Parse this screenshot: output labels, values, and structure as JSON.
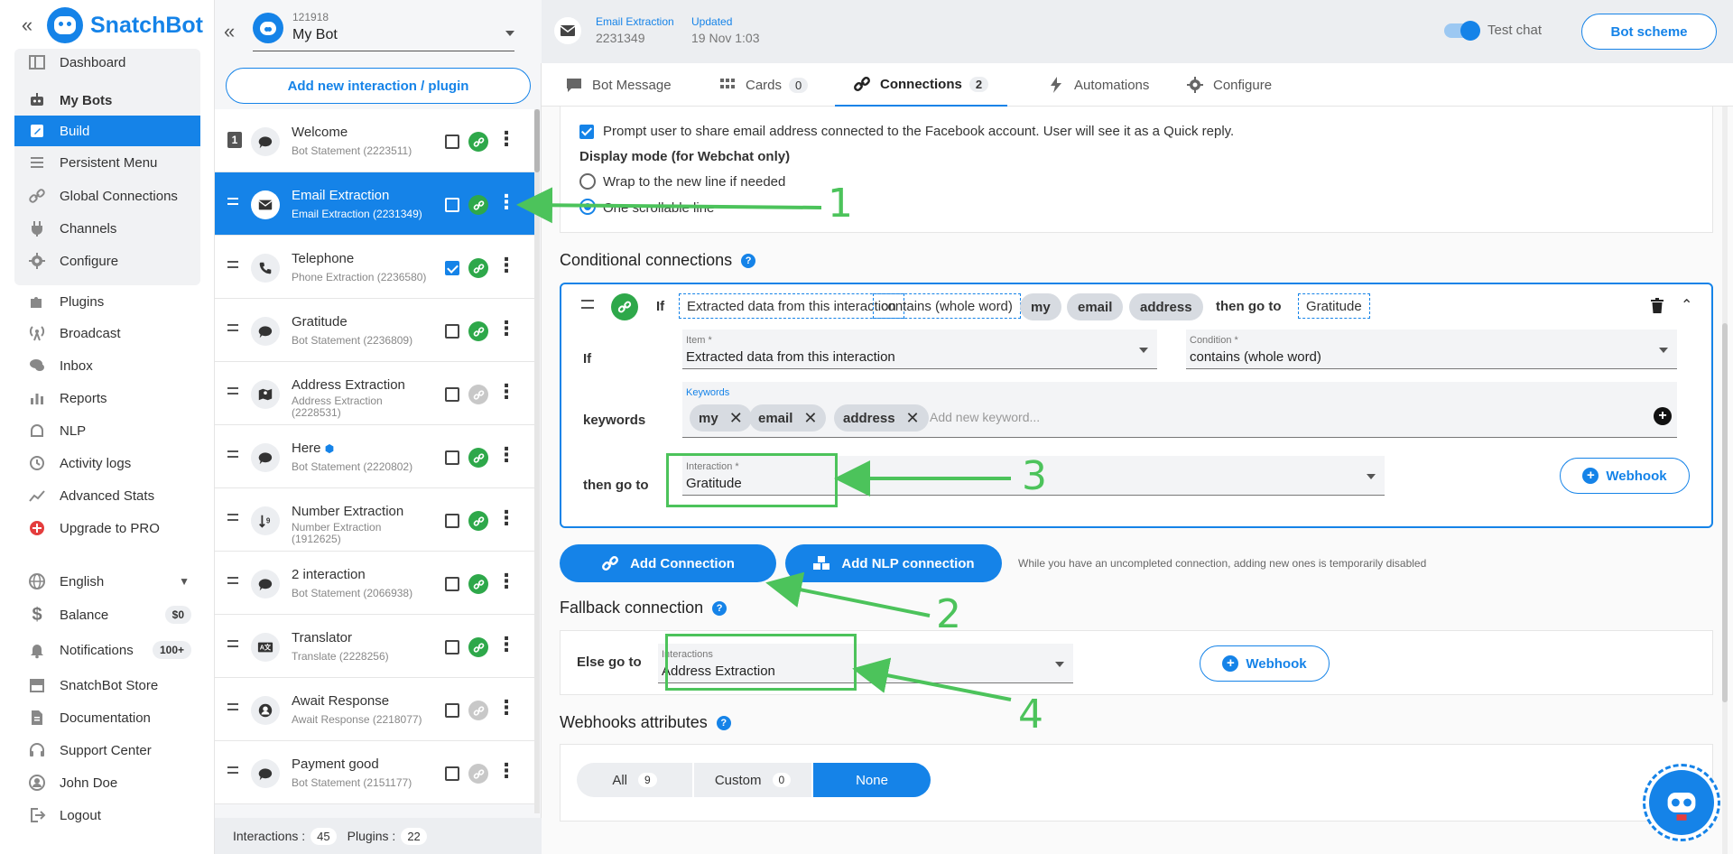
{
  "app": {
    "brand": "SnatchBot",
    "collapse_icon": "double-chevron-left-icon"
  },
  "nav": {
    "group1": [
      {
        "label": "Dashboard",
        "icon": "dashboard-icon"
      },
      {
        "label": "My Bots",
        "icon": "robot-icon"
      },
      {
        "label": "Build",
        "icon": "edit-icon"
      },
      {
        "label": "Persistent Menu",
        "icon": "menu-icon"
      },
      {
        "label": "Global Connections",
        "icon": "link-icon"
      },
      {
        "label": "Channels",
        "icon": "plug-icon"
      },
      {
        "label": "Configure",
        "icon": "gear-icon"
      }
    ],
    "group2": [
      {
        "label": "Plugins",
        "icon": "puzzle-icon"
      },
      {
        "label": "Broadcast",
        "icon": "broadcast-icon"
      },
      {
        "label": "Inbox",
        "icon": "chat-icon"
      },
      {
        "label": "Reports",
        "icon": "bar-chart-icon"
      },
      {
        "label": "NLP",
        "icon": "nlp-icon"
      },
      {
        "label": "Activity logs",
        "icon": "history-icon"
      },
      {
        "label": "Advanced Stats",
        "icon": "trend-icon"
      },
      {
        "label": "Upgrade to PRO",
        "icon": "upgrade-icon"
      }
    ],
    "group3": [
      {
        "label": "English",
        "icon": "globe-icon"
      },
      {
        "label": "Balance",
        "icon": "dollar-icon",
        "badge": "$0"
      },
      {
        "label": "Notifications",
        "icon": "bell-icon",
        "badge": "100+"
      },
      {
        "label": "SnatchBot Store",
        "icon": "store-icon"
      },
      {
        "label": "Documentation",
        "icon": "document-icon"
      },
      {
        "label": "Support Center",
        "icon": "support-icon"
      },
      {
        "label": "John Doe",
        "icon": "user-icon"
      },
      {
        "label": "Logout",
        "icon": "logout-icon"
      }
    ]
  },
  "bot": {
    "id": "121918",
    "name": "My Bot"
  },
  "interactions_panel": {
    "add_button": "Add new interaction / plugin",
    "items": [
      {
        "title": "Welcome",
        "subtitle": "Bot Statement (2223511)",
        "icon": "speech-bubble-icon",
        "order": "1",
        "checked": false,
        "linked": true
      },
      {
        "title": "Email Extraction",
        "subtitle": "Email Extraction (2231349)",
        "icon": "envelope-icon",
        "checked": false,
        "linked": true,
        "active": true
      },
      {
        "title": "Telephone",
        "subtitle": "Phone Extraction (2236580)",
        "icon": "phone-icon",
        "checked": true,
        "linked": true
      },
      {
        "title": "Gratitude",
        "subtitle": "Bot Statement (2236809)",
        "icon": "speech-bubble-icon",
        "checked": false,
        "linked": true
      },
      {
        "title": "Address Extraction",
        "subtitle": "Address Extraction (2228531)",
        "icon": "map-icon",
        "checked": false,
        "linked": false
      },
      {
        "title": "Here",
        "subtitle": "Bot Statement (2220802)",
        "icon": "speech-bubble-icon",
        "checked": false,
        "linked": true
      },
      {
        "title": "Number Extraction",
        "subtitle": "Number Extraction (1912625)",
        "icon": "number-icon",
        "checked": false,
        "linked": true
      },
      {
        "title": "2 interaction",
        "subtitle": "Bot Statement (2066938)",
        "icon": "speech-bubble-icon",
        "checked": false,
        "linked": true
      },
      {
        "title": "Translator",
        "subtitle": "Translate (2228256)",
        "icon": "translate-icon",
        "checked": false,
        "linked": true
      },
      {
        "title": "Await Response",
        "subtitle": "Await Response (2218077)",
        "icon": "user-circle-icon",
        "checked": false,
        "linked": false
      },
      {
        "title": "Payment good",
        "subtitle": "Bot Statement (2151177)",
        "icon": "speech-bubble-icon",
        "checked": false,
        "linked": false
      }
    ],
    "footer": {
      "interactions_label": "Interactions :",
      "interactions_count": "45",
      "plugins_label": "Plugins :",
      "plugins_count": "22"
    }
  },
  "header": {
    "interaction_type": "Email Extraction",
    "interaction_id": "2231349",
    "updated_label": "Updated",
    "updated_value": "19 Nov 1:03",
    "test_chat_label": "Test chat",
    "bot_scheme_label": "Bot scheme"
  },
  "tabs": [
    {
      "label": "Bot Message",
      "icon": "message-icon"
    },
    {
      "label": "Cards",
      "icon": "grid-icon",
      "badge": "0"
    },
    {
      "label": "Connections",
      "icon": "link-icon",
      "badge": "2",
      "active": true
    },
    {
      "label": "Automations",
      "icon": "bolt-icon"
    },
    {
      "label": "Configure",
      "icon": "gear-icon"
    }
  ],
  "settings_card": {
    "prompt_text": "Prompt user to share email address connected to the Facebook account. User will see it as a Quick reply.",
    "display_mode_label": "Display mode (for Webchat only)",
    "radio_wrap": "Wrap to the new line if needed",
    "radio_scroll": "One scrollable line"
  },
  "conditional": {
    "title": "Conditional connections",
    "summary": {
      "if": "If",
      "item": "Extracted data from this interaction",
      "condition": "contains (whole word)",
      "keywords": [
        "my",
        "email",
        "address"
      ],
      "then_go_to": "then go to",
      "target": "Gratitude"
    },
    "if_label": "If",
    "item_label": "Item *",
    "item_value": "Extracted data from this interaction",
    "condition_label": "Condition *",
    "condition_value": "contains (whole word)",
    "keywords_row_label": "keywords",
    "keywords_field_label": "Keywords",
    "keywords": [
      "my",
      "email",
      "address"
    ],
    "keyword_placeholder": "Add new keyword...",
    "then_label": "then go to",
    "interaction_label": "Interaction *",
    "interaction_value": "Gratitude",
    "webhook_label": "Webhook"
  },
  "actions": {
    "add_connection": "Add Connection",
    "add_nlp": "Add NLP connection",
    "note": "While you have an uncompleted connection, adding new ones is temporarily disabled"
  },
  "fallback": {
    "title": "Fallback connection",
    "else_label": "Else go to",
    "interactions_label": "Interactions",
    "interactions_value": "Address Extraction",
    "webhook_label": "Webhook"
  },
  "webhooks_attributes": {
    "title": "Webhooks attributes",
    "segments": [
      {
        "label": "All",
        "count": "9"
      },
      {
        "label": "Custom",
        "count": "0"
      },
      {
        "label": "None",
        "active": true
      }
    ]
  },
  "annotations": {
    "n1": "1",
    "n2": "2",
    "n3": "3",
    "n4": "4",
    "color": "#4cc35b"
  },
  "colors": {
    "primary": "#1583e8",
    "success": "#2ea84a",
    "annotation": "#4cc35b"
  }
}
